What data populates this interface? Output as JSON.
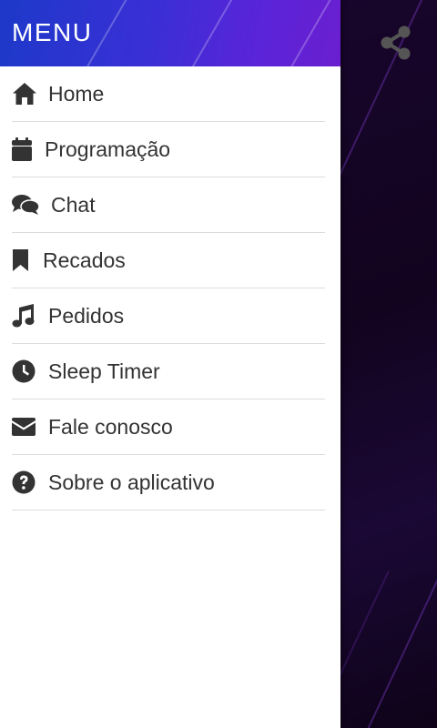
{
  "drawer": {
    "title": "MENU",
    "items": [
      {
        "label": "Home",
        "icon": "home-icon"
      },
      {
        "label": "Programação",
        "icon": "calendar-icon"
      },
      {
        "label": "Chat",
        "icon": "chat-icon"
      },
      {
        "label": "Recados",
        "icon": "bookmark-icon"
      },
      {
        "label": "Pedidos",
        "icon": "music-note-icon"
      },
      {
        "label": "Sleep Timer",
        "icon": "clock-icon"
      },
      {
        "label": "Fale conosco",
        "icon": "envelope-icon"
      },
      {
        "label": "Sobre o aplicativo",
        "icon": "question-circle-icon"
      }
    ]
  },
  "topbar": {
    "share_icon": "share-icon"
  },
  "colors": {
    "header_start": "#1d39c9",
    "header_end": "#6a1fd0",
    "icon": "#333333",
    "text": "#333333",
    "divider": "#dcdcdc",
    "share_icon": "#555555"
  }
}
